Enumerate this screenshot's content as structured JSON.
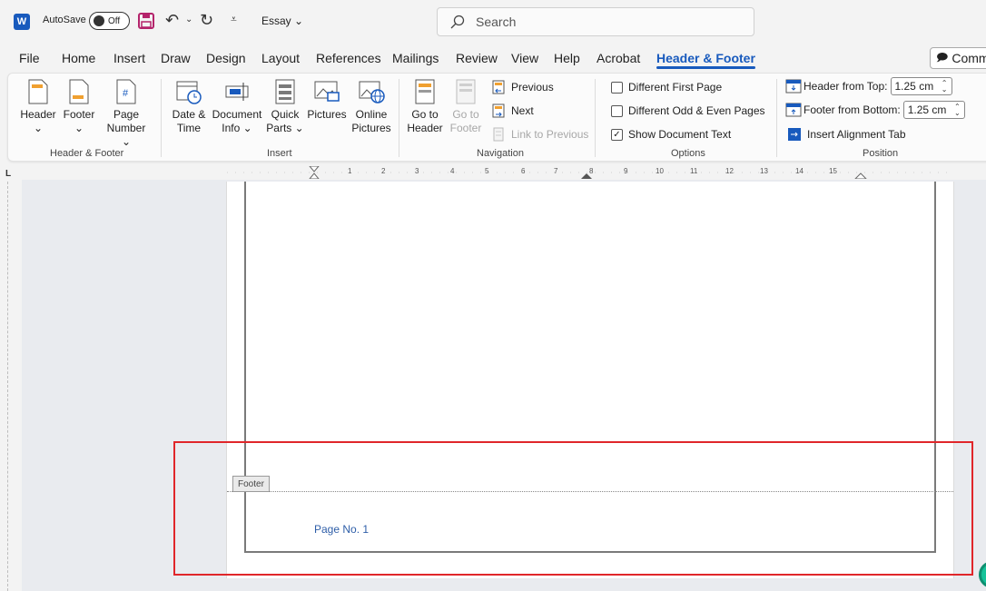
{
  "titlebar": {
    "app_logo": "W",
    "autosave_label": "AutoSave",
    "autosave_state": "Off",
    "doc_title": "Essay ⌄",
    "search_placeholder": "Search"
  },
  "tabs": [
    "File",
    "Home",
    "Insert",
    "Draw",
    "Design",
    "Layout",
    "References",
    "Mailings",
    "Review",
    "View",
    "Help",
    "Acrobat",
    "Header & Footer"
  ],
  "active_tab": "Header & Footer",
  "comments_label": "Comme",
  "ribbon": {
    "header_footer": {
      "header": "Header",
      "header_drop": "⌄",
      "footer": "Footer",
      "footer_drop": "⌄",
      "page_number_1": "Page",
      "page_number_2": "Number ⌄",
      "label": "Header & Footer"
    },
    "insert": {
      "date_time_1": "Date &",
      "date_time_2": "Time",
      "document_info_1": "Document",
      "document_info_2": "Info ⌄",
      "quick_parts_1": "Quick",
      "quick_parts_2": "Parts ⌄",
      "pictures": "Pictures",
      "online_pictures_1": "Online",
      "online_pictures_2": "Pictures",
      "label": "Insert"
    },
    "navigation": {
      "go_to_header_1": "Go to",
      "go_to_header_2": "Header",
      "go_to_footer_1": "Go to",
      "go_to_footer_2": "Footer",
      "previous": "Previous",
      "next": "Next",
      "link_to_previous": "Link to Previous",
      "label": "Navigation"
    },
    "options": {
      "different_first_page": "Different First Page",
      "different_odd_even": "Different Odd & Even Pages",
      "show_document_text": "Show Document Text",
      "show_document_text_checked": "✓",
      "label": "Options"
    },
    "position": {
      "header_from_top_label": "Header from Top:",
      "header_from_top_value": "1.25 cm",
      "footer_from_bottom_label": "Footer from Bottom:",
      "footer_from_bottom_value": "1.25 cm",
      "insert_alignment_tab": "Insert Alignment Tab",
      "label": "Position"
    }
  },
  "ruler": {
    "corner": "L",
    "marks": [
      "1",
      "2",
      "3",
      "4",
      "5",
      "6",
      "7",
      "8",
      "9",
      "10",
      "11",
      "12",
      "13",
      "14",
      "15"
    ]
  },
  "document": {
    "footer_tag": "Footer",
    "page_number_text": "Page No. 1"
  },
  "colors": {
    "accent": "#185abd",
    "highlight": "#e0262a",
    "page_number": "#2e5ea8"
  }
}
